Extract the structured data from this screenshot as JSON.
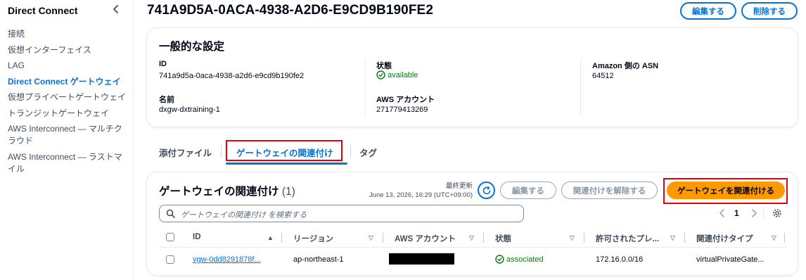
{
  "sidebar": {
    "title": "Direct Connect",
    "items": [
      {
        "label": "接続"
      },
      {
        "label": "仮想インターフェイス"
      },
      {
        "label": "LAG"
      },
      {
        "label": "Direct Connect ゲートウェイ"
      },
      {
        "label": "仮想プライベートゲートウェイ"
      },
      {
        "label": "トランジットゲートウェイ"
      },
      {
        "label": "AWS Interconnect — マルチクラウド"
      },
      {
        "label": "AWS Interconnect — ラストマイル"
      }
    ],
    "active_index": 3
  },
  "header": {
    "title": "741A9D5A-0ACA-4938-A2D6-E9CD9B190FE2",
    "edit_label": "編集する",
    "delete_label": "削除する"
  },
  "general": {
    "title": "一般的な設定",
    "id_label": "ID",
    "id_value": "741a9d5a-0aca-4938-a2d6-e9cd9b190fe2",
    "status_label": "状態",
    "status_value": "available",
    "asn_label": "Amazon 側の ASN",
    "asn_value": "64512",
    "name_label": "名前",
    "name_value": "dxgw-dxtraining-1",
    "account_label": "AWS アカウント",
    "account_value": "271779413269"
  },
  "tabs": [
    {
      "label": "添付ファイル"
    },
    {
      "label": "ゲートウェイの関連付け"
    },
    {
      "label": "タグ"
    }
  ],
  "associations": {
    "title": "ゲートウェイの関連付け",
    "count": "(1)",
    "last_updated_label": "最終更新",
    "last_updated_value": "June 13, 2026, 16:29 (UTC+09:00)",
    "edit_label": "編集する",
    "disassociate_label": "関連付けを解除する",
    "associate_label": "ゲートウェイを関連付ける",
    "search_placeholder": "ゲートウェイの関連付け を検索する",
    "page": "1",
    "columns": [
      "ID",
      "リージョン",
      "AWS アカウント",
      "状態",
      "許可されたプレ...",
      "関連付けタイプ"
    ],
    "rows": [
      {
        "id": "vgw-0dd8291878f...",
        "region": "ap-northeast-1",
        "account": "",
        "status": "associated",
        "prefixes": "172.16.0.0/16",
        "type": "virtualPrivateGate..."
      }
    ]
  },
  "colors": {
    "accent": "#0972d3",
    "primary_button": "#ff9900",
    "success": "#037f0c",
    "highlight_box": "#e3000f"
  }
}
